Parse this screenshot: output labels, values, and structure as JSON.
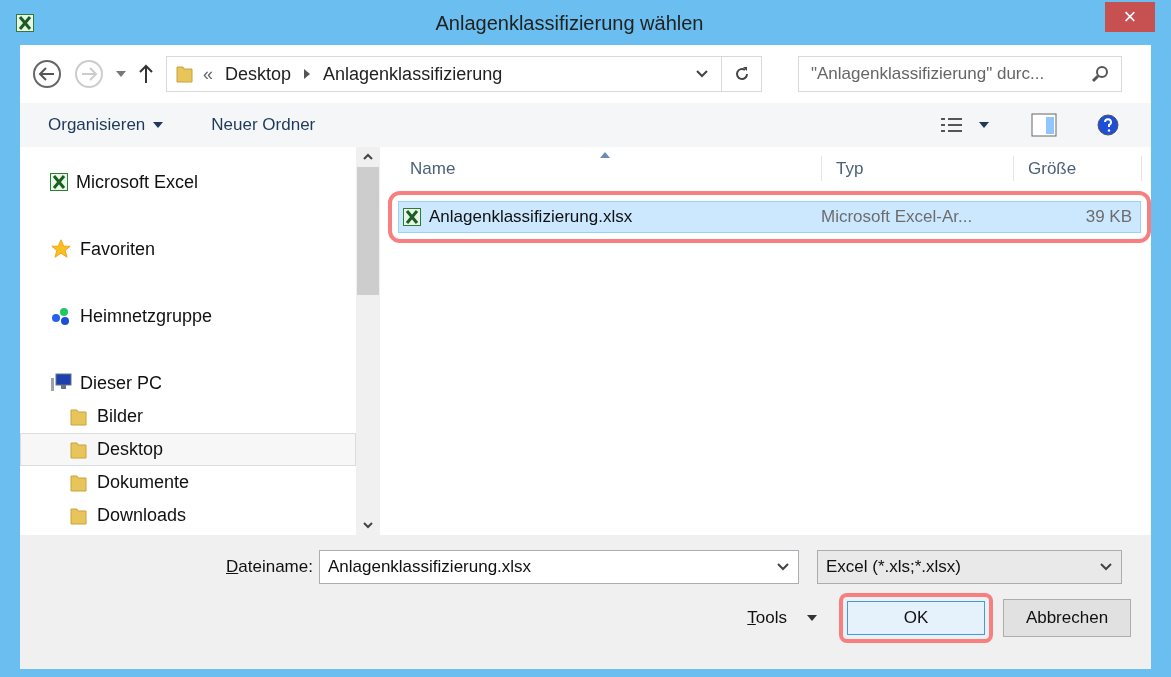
{
  "window": {
    "title": "Anlagenklassifizierung wählen",
    "close": "×"
  },
  "address": {
    "overflow": "«",
    "path": [
      "Desktop",
      "Anlagenklassifizierung"
    ],
    "search_placeholder": "\"Anlagenklassifizierung\" durc..."
  },
  "toolbar": {
    "organize": "Organisieren",
    "new_folder": "Neuer Ordner"
  },
  "sidebar": [
    {
      "label": "Microsoft Excel",
      "kind": "excel",
      "selected": false
    },
    {
      "label": "Favoriten",
      "kind": "star",
      "selected": false
    },
    {
      "label": "Heimnetzgruppe",
      "kind": "network",
      "selected": false
    },
    {
      "label": "Dieser PC",
      "kind": "pc",
      "selected": false,
      "children": [
        {
          "label": "Bilder",
          "kind": "folder",
          "selected": false
        },
        {
          "label": "Desktop",
          "kind": "folder",
          "selected": true
        },
        {
          "label": "Dokumente",
          "kind": "folder",
          "selected": false
        },
        {
          "label": "Downloads",
          "kind": "folder",
          "selected": false
        }
      ]
    }
  ],
  "table": {
    "columns": [
      "Name",
      "Typ",
      "Größe"
    ],
    "rows": [
      {
        "name": "Anlagenklassifizierung.xlsx",
        "type": "Microsoft Excel-Ar...",
        "size": "39 KB",
        "selected": true,
        "highlighted": true
      }
    ]
  },
  "footer": {
    "filename_label": "Dateiname:",
    "filename_value": "Anlagenklassifizierung.xlsx",
    "filter": "Excel (*.xls;*.xlsx)",
    "tools": "Tools",
    "ok": {
      "label": "OK",
      "highlighted": true
    },
    "cancel": "Abbrechen"
  }
}
